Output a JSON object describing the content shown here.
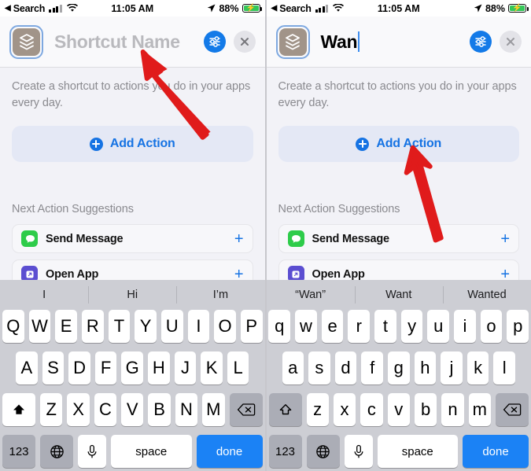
{
  "meta": {
    "accent_blue": "#1673e3",
    "keyboard_bg": "#cdced4",
    "panel_bg": "#f2f2f7",
    "annotation_arrow_color": "#e01b1b"
  },
  "status_bar": {
    "back_glyph": "◀",
    "carrier_label": "Search",
    "signal_icon": "cellular-bars-icon",
    "wifi_icon": "wifi-icon",
    "time": "11:05 AM",
    "location_icon": "location-arrow-icon",
    "battery_percent": "88%",
    "battery_icon": "battery-charging-icon"
  },
  "panels": [
    {
      "id": "left",
      "navbar": {
        "icon_name": "shortcut-glyph-icon",
        "icon_bg": "#a19489",
        "name_field": {
          "value": "",
          "placeholder": "Shortcut Name",
          "caret_visible": false
        },
        "settings_button": {
          "icon": "sliders-icon",
          "label": ""
        },
        "close_button": {
          "icon": "close-x-icon",
          "label": ""
        }
      },
      "blurb": "Create a shortcut to actions you do in your apps every day.",
      "add_action": {
        "label": "Add Action",
        "icon": "plus-circle-icon"
      },
      "section_title": "Next Action Suggestions",
      "suggestions": [
        {
          "label": "Send Message",
          "icon": "messages-app-icon",
          "icon_bg": "#2ecc4a",
          "add_icon": "plus-icon"
        },
        {
          "label": "Open App",
          "icon": "open-app-icon",
          "icon_bg": "#5b4ed1",
          "add_icon": "plus-icon"
        }
      ],
      "keyboard": {
        "predictions": [
          "I",
          "Hi",
          "I’m"
        ],
        "row1": [
          "Q",
          "W",
          "E",
          "R",
          "T",
          "Y",
          "U",
          "I",
          "O",
          "P"
        ],
        "row2": [
          "A",
          "S",
          "D",
          "F",
          "G",
          "H",
          "J",
          "K",
          "L"
        ],
        "row3": [
          "Z",
          "X",
          "C",
          "V",
          "B",
          "N",
          "M"
        ],
        "shift": {
          "icon": "shift-filled-icon",
          "active": true
        },
        "backspace": {
          "icon": "backspace-icon"
        },
        "numbers_key": "123",
        "globe_key": {
          "icon": "globe-icon"
        },
        "mic_key": {
          "icon": "microphone-icon"
        },
        "space_key": "space",
        "return_key": "done"
      }
    },
    {
      "id": "right",
      "navbar": {
        "icon_name": "shortcut-glyph-icon",
        "icon_bg": "#a19489",
        "name_field": {
          "value": "Wan",
          "placeholder": "Shortcut Name",
          "caret_visible": true
        },
        "settings_button": {
          "icon": "sliders-icon",
          "label": ""
        },
        "close_button": {
          "icon": "close-x-icon",
          "label": ""
        }
      },
      "blurb": "Create a shortcut to actions you do in your apps every day.",
      "add_action": {
        "label": "Add Action",
        "icon": "plus-circle-icon"
      },
      "section_title": "Next Action Suggestions",
      "suggestions": [
        {
          "label": "Send Message",
          "icon": "messages-app-icon",
          "icon_bg": "#2ecc4a",
          "add_icon": "plus-icon"
        },
        {
          "label": "Open App",
          "icon": "open-app-icon",
          "icon_bg": "#5b4ed1",
          "add_icon": "plus-icon"
        }
      ],
      "keyboard": {
        "predictions": [
          "“Wan”",
          "Want",
          "Wanted"
        ],
        "row1": [
          "q",
          "w",
          "e",
          "r",
          "t",
          "y",
          "u",
          "i",
          "o",
          "p"
        ],
        "row2": [
          "a",
          "s",
          "d",
          "f",
          "g",
          "h",
          "j",
          "k",
          "l"
        ],
        "row3": [
          "z",
          "x",
          "c",
          "v",
          "b",
          "n",
          "m"
        ],
        "shift": {
          "icon": "shift-outline-icon",
          "active": false
        },
        "backspace": {
          "icon": "backspace-icon"
        },
        "numbers_key": "123",
        "globe_key": {
          "icon": "globe-icon"
        },
        "mic_key": {
          "icon": "microphone-icon"
        },
        "space_key": "space",
        "return_key": "done"
      }
    }
  ],
  "annotations": [
    {
      "name": "arrow-pointing-to-shortcut-name-field",
      "panel": "left"
    },
    {
      "name": "arrow-pointing-to-add-action-button",
      "panel": "right"
    }
  ]
}
